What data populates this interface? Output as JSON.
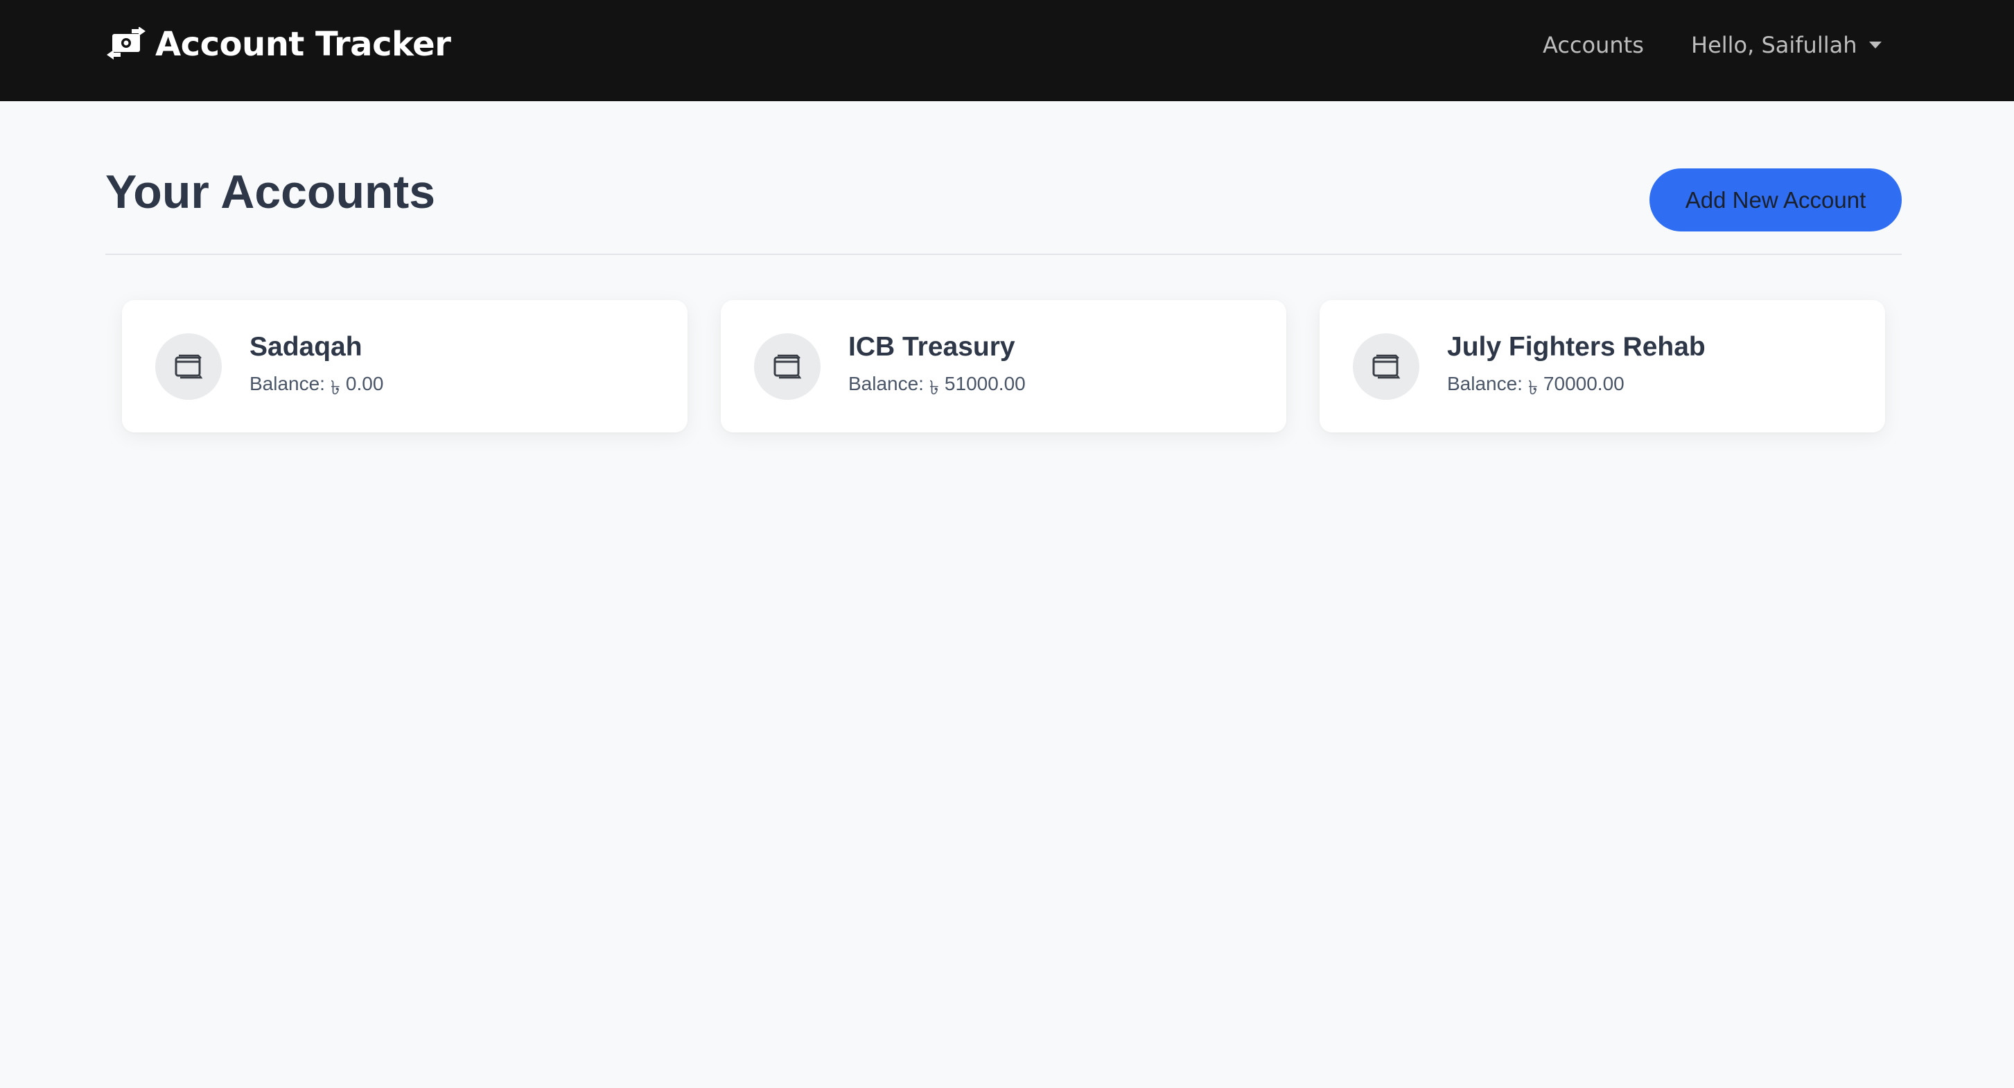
{
  "navbar": {
    "brand_icon": "money-bill-transfer-icon",
    "brand_text": "Account Tracker",
    "links": {
      "accounts": "Accounts",
      "user_greeting": "Hello, Saifullah"
    }
  },
  "main": {
    "title": "Your Accounts",
    "add_button_label": "Add New Account"
  },
  "accounts": [
    {
      "name": "Sadaqah",
      "balance_label": "Balance:",
      "currency": "৳",
      "amount": "0.00",
      "icon": "wallet-icon"
    },
    {
      "name": "ICB Treasury",
      "balance_label": "Balance:",
      "currency": "৳",
      "amount": "51000.00",
      "icon": "wallet-icon"
    },
    {
      "name": "July Fighters Rehab",
      "balance_label": "Balance:",
      "currency": "৳",
      "amount": "70000.00",
      "icon": "wallet-icon"
    }
  ],
  "colors": {
    "navbar_bg": "#121212",
    "page_bg": "#f8f9fa",
    "accent": "#2f6ef2",
    "title_text": "#2d3748"
  }
}
